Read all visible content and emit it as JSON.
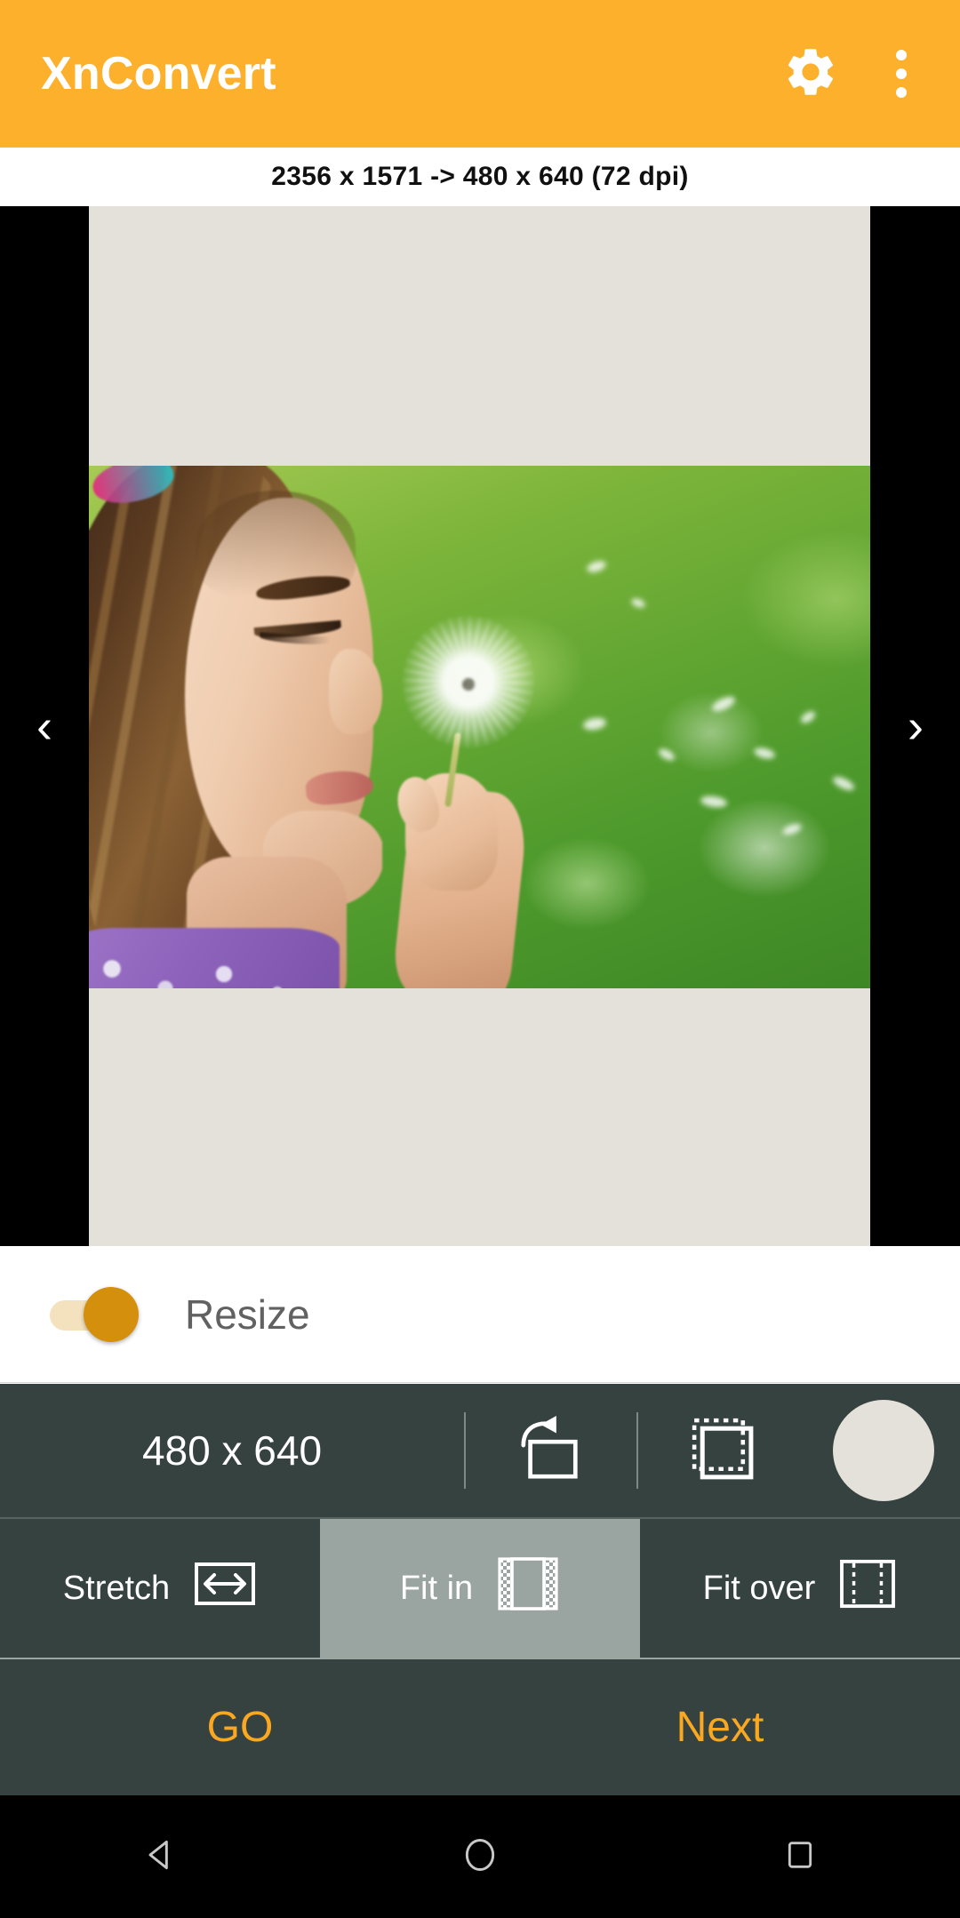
{
  "appbar": {
    "title": "XnConvert",
    "background": "#FDB02B",
    "settings_icon": "gear-icon",
    "overflow_icon": "three-dot-menu-icon"
  },
  "info": {
    "text": "2356 x 1571 -> 480 x 640  (72 dpi)",
    "source_dimensions": "2356 x 1571",
    "target_dimensions": "480 x 640",
    "dpi": "72 dpi"
  },
  "preview": {
    "prev_arrow": "‹",
    "next_arrow": "›",
    "canvas_background": "#E4E0DA",
    "letterbox_background": "#000000",
    "image_description": "girl blowing a dandelion seed head in a green field"
  },
  "resize": {
    "label": "Resize",
    "enabled": true,
    "accent": "#D4900C",
    "track": "#F4E2BE"
  },
  "dimensions": {
    "value": "480 x 640",
    "rotate_icon": "rotate-icon",
    "keep_ratio_icon": "canvas-ratio-icon",
    "color_swatch": "#E4E0DA",
    "panel_background": "#35423F"
  },
  "fit_modes": {
    "selected": "Fit in",
    "options": [
      {
        "label": "Stretch",
        "icon": "stretch-arrows-icon",
        "selected": false
      },
      {
        "label": "Fit in",
        "icon": "fit-in-icon",
        "selected": true
      },
      {
        "label": "Fit over",
        "icon": "fit-over-icon",
        "selected": false
      }
    ]
  },
  "actions": {
    "go_label": "GO",
    "next_label": "Next",
    "accent": "#FAA722"
  },
  "system_nav": {
    "back": "back-triangle-icon",
    "home": "home-circle-icon",
    "recents": "recents-square-icon"
  }
}
